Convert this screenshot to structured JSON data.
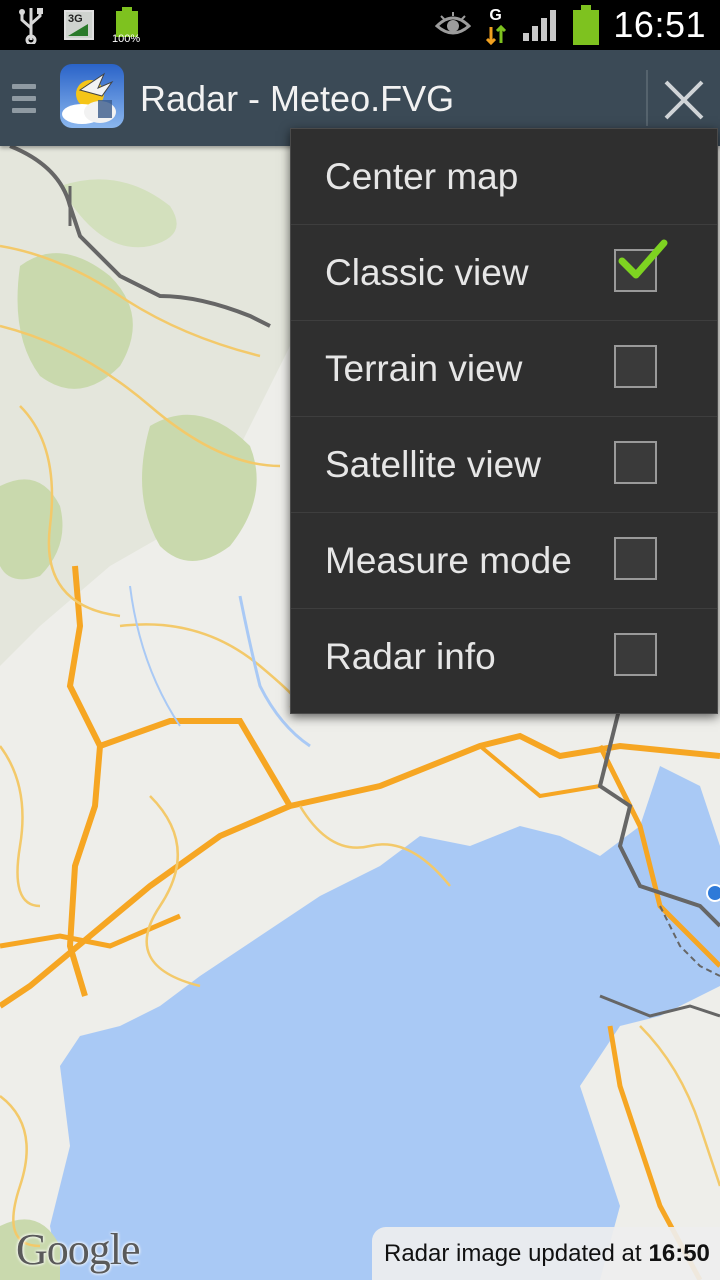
{
  "status_bar": {
    "network_badge": "3G",
    "battery_percent": "100%",
    "data_badge": "G",
    "time": "16:51",
    "icons": [
      "usb-icon",
      "sim-3g-icon",
      "battery-small-icon",
      "eye-icon",
      "data-arrows-icon",
      "signal-icon",
      "battery-icon"
    ]
  },
  "action_bar": {
    "title": "Radar - Meteo.FVG",
    "icons": [
      "drawer-icon",
      "app-logo",
      "close-icon"
    ],
    "background_color": "#3b4a56"
  },
  "menu": {
    "items": [
      {
        "label": "Center map",
        "has_checkbox": false
      },
      {
        "label": "Classic view",
        "has_checkbox": true,
        "checked": true
      },
      {
        "label": "Terrain view",
        "has_checkbox": true,
        "checked": false
      },
      {
        "label": "Satellite view",
        "has_checkbox": true,
        "checked": false
      },
      {
        "label": "Measure mode",
        "has_checkbox": true,
        "checked": false
      },
      {
        "label": "Radar info",
        "has_checkbox": true,
        "checked": false
      }
    ],
    "check_color": "#7ed321"
  },
  "map": {
    "attribution": "Google",
    "radar_updated_label": "Radar image updated at",
    "radar_updated_time": "16:50",
    "colors": {
      "sea": "#a9c9f5",
      "land": "#eeeeea",
      "hills": "#c8d9ad",
      "highway": "#f6a623",
      "road": "#f3c96a",
      "border": "#666666"
    }
  }
}
